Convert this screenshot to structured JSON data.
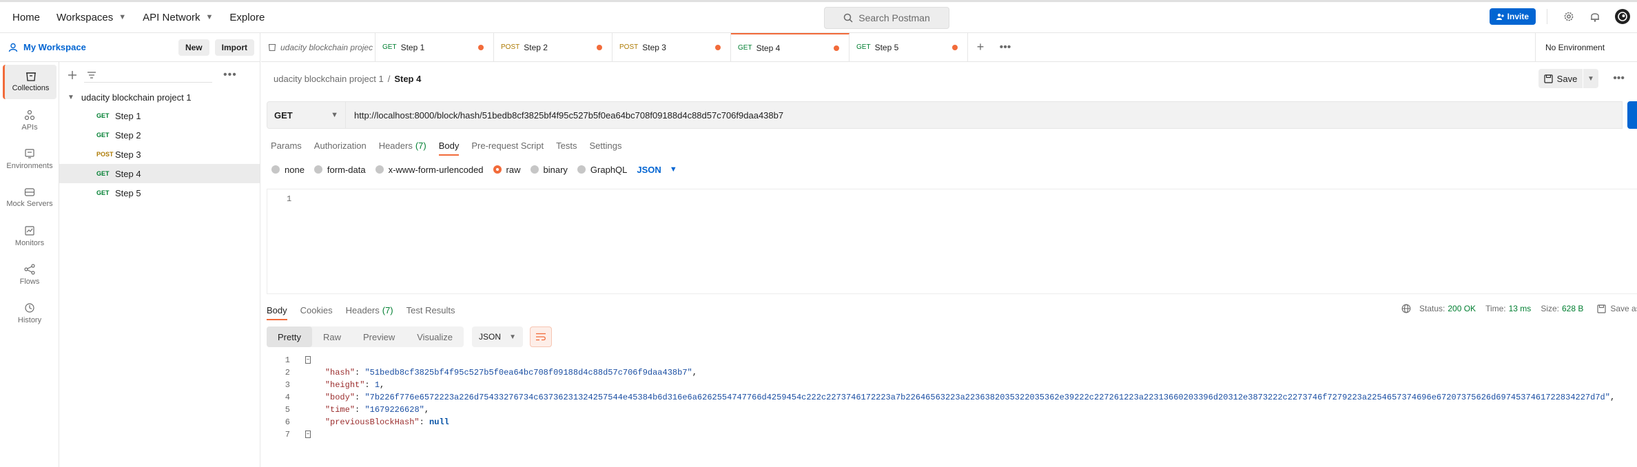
{
  "topnav": {
    "home": "Home",
    "workspaces": "Workspaces",
    "api_network": "API Network",
    "explore": "Explore"
  },
  "search": {
    "placeholder": "Search Postman"
  },
  "topright": {
    "invite": "Invite"
  },
  "workspace": {
    "title": "My Workspace",
    "new_label": "New",
    "import_label": "Import"
  },
  "rail": [
    {
      "label": "Collections",
      "icon": "collections-icon"
    },
    {
      "label": "APIs",
      "icon": "apis-icon"
    },
    {
      "label": "Environments",
      "icon": "environments-icon"
    },
    {
      "label": "Mock Servers",
      "icon": "mock-servers-icon"
    },
    {
      "label": "Monitors",
      "icon": "monitors-icon"
    },
    {
      "label": "Flows",
      "icon": "flows-icon"
    },
    {
      "label": "History",
      "icon": "history-icon"
    }
  ],
  "tree": {
    "collection": "udacity blockchain project 1",
    "requests": [
      {
        "method": "GET",
        "name": "Step 1"
      },
      {
        "method": "GET",
        "name": "Step 2"
      },
      {
        "method": "POST",
        "name": "Step 3"
      },
      {
        "method": "GET",
        "name": "Step 4"
      },
      {
        "method": "GET",
        "name": "Step 5"
      }
    ]
  },
  "tabs": [
    {
      "label": "udacity blockchain projec"
    },
    {
      "method": "GET",
      "label": "Step 1"
    },
    {
      "method": "POST",
      "label": "Step 2"
    },
    {
      "method": "POST",
      "label": "Step 3"
    },
    {
      "method": "GET",
      "label": "Step 4"
    },
    {
      "method": "GET",
      "label": "Step 5"
    }
  ],
  "environment": "No Environment",
  "breadcrumb": {
    "parent": "udacity blockchain project 1",
    "separator": "/",
    "current": "Step 4"
  },
  "save_label": "Save",
  "request": {
    "method": "GET",
    "url": "http://localhost:8000/block/hash/51bedb8cf3825bf4f95c527b5f0ea64bc708f09188d4c88d57c706f9daa438b7"
  },
  "request_tabs": {
    "params": "Params",
    "authorization": "Authorization",
    "headers": "Headers",
    "headers_count": "(7)",
    "body": "Body",
    "prerequest": "Pre-request Script",
    "tests": "Tests",
    "settings": "Settings"
  },
  "body_types": {
    "none": "none",
    "form_data": "form-data",
    "urlencoded": "x-www-form-urlencoded",
    "raw": "raw",
    "binary": "binary",
    "graphql": "GraphQL",
    "format": "JSON"
  },
  "editor": {
    "line": "1"
  },
  "response_tabs": {
    "body": "Body",
    "cookies": "Cookies",
    "headers": "Headers",
    "headers_count": "(7)",
    "test_results": "Test Results"
  },
  "response_meta": {
    "status_label": "Status:",
    "status": "200 OK",
    "time_label": "Time:",
    "time": "13 ms",
    "size_label": "Size:",
    "size": "628 B",
    "save_as": "Save as"
  },
  "view_modes": {
    "pretty": "Pretty",
    "raw": "Raw",
    "preview": "Preview",
    "visualize": "Visualize",
    "format": "JSON"
  },
  "response_body": {
    "lines": [
      "1",
      "2",
      "3",
      "4",
      "5",
      "6",
      "7"
    ],
    "hash_key": "\"hash\"",
    "hash_value": "\"51bedb8cf3825bf4f95c527b5f0ea64bc708f09188d4c88d57c706f9daa438b7\"",
    "height_key": "\"height\"",
    "height_value": "1",
    "body_key": "\"body\"",
    "body_value": "\"7b226f776e6572223a226d75433276734c63736231324257544e45384b6d316e6a6262554747766d4259454c222c2273746172223a7b22646563223a2236382035322035362e39222c227261223a22313660203396d20312e3873222c2273746f7279223a2254657374696e67207375626d6974537461722834227d7d\"",
    "time_key": "\"time\"",
    "time_value": "\"1679226628\"",
    "prev_key": "\"previousBlockHash\"",
    "prev_value": "null"
  },
  "colors": {
    "accent": "#f26b3a",
    "brand_blue": "#0265d2",
    "get": "#007f31",
    "post": "#ad7a03"
  }
}
